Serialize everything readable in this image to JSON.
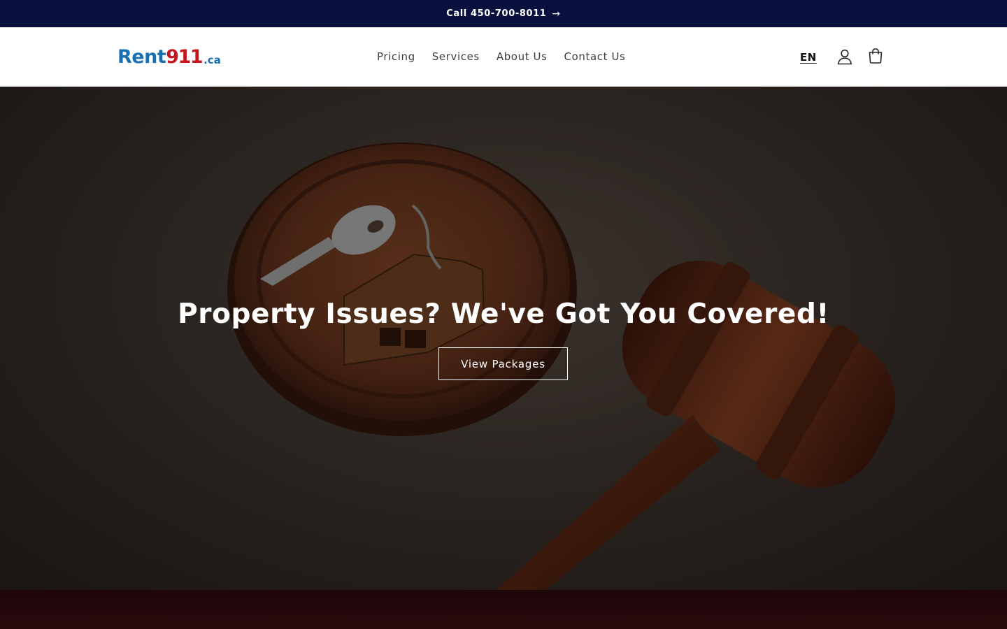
{
  "announcement": {
    "text": "Call 450-700-8011",
    "arrow": "→"
  },
  "logo": {
    "part1": "Rent",
    "part2": "911",
    "part3": ".ca"
  },
  "nav": {
    "items": [
      {
        "label": "Pricing"
      },
      {
        "label": "Services"
      },
      {
        "label": "About Us"
      },
      {
        "label": "Contact Us"
      }
    ]
  },
  "header": {
    "language": "EN",
    "account_icon": "account-icon",
    "cart_icon": "cart-icon"
  },
  "hero": {
    "title": "Property Issues? We've Got You Covered!",
    "button_label": "View Packages"
  },
  "colors": {
    "announcement_bg": "#08113e",
    "logo_blue": "#1a6fb0",
    "logo_red": "#c4161c",
    "footer_band": "#2b0a0d"
  }
}
